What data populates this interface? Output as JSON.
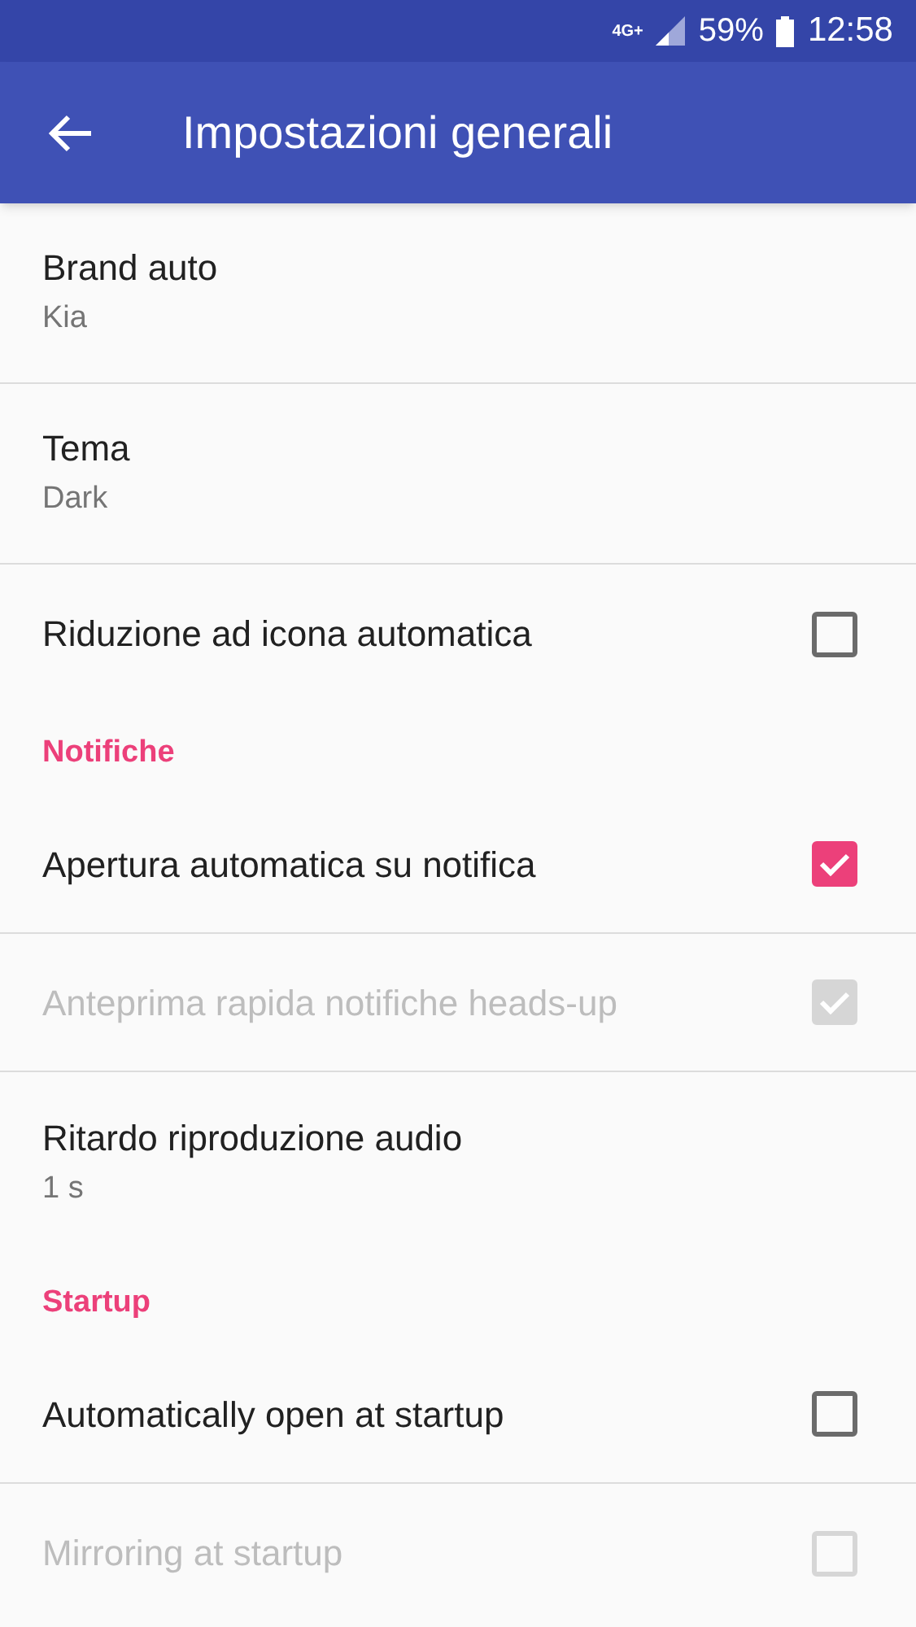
{
  "status_bar": {
    "network": "4G+",
    "battery": "59%",
    "time": "12:58"
  },
  "app_bar": {
    "title": "Impostazioni generali"
  },
  "items": [
    {
      "kind": "setting",
      "title": "Brand auto",
      "summary": "Kia"
    },
    {
      "kind": "setting",
      "title": "Tema",
      "summary": "Dark"
    },
    {
      "kind": "checkbox",
      "title": "Riduzione ad icona automatica",
      "checked": false,
      "disabled": false
    },
    {
      "kind": "category",
      "title": "Notifiche"
    },
    {
      "kind": "checkbox",
      "title": "Apertura automatica su notifica",
      "checked": true,
      "disabled": false
    },
    {
      "kind": "checkbox",
      "title": "Anteprima rapida notifiche heads-up",
      "checked": true,
      "disabled": true
    },
    {
      "kind": "setting",
      "title": "Ritardo riproduzione audio",
      "summary": "1 s"
    },
    {
      "kind": "category",
      "title": "Startup"
    },
    {
      "kind": "checkbox",
      "title": "Automatically open at startup",
      "checked": false,
      "disabled": false
    },
    {
      "kind": "checkbox",
      "title": "Mirroring at startup",
      "checked": false,
      "disabled": true
    }
  ]
}
